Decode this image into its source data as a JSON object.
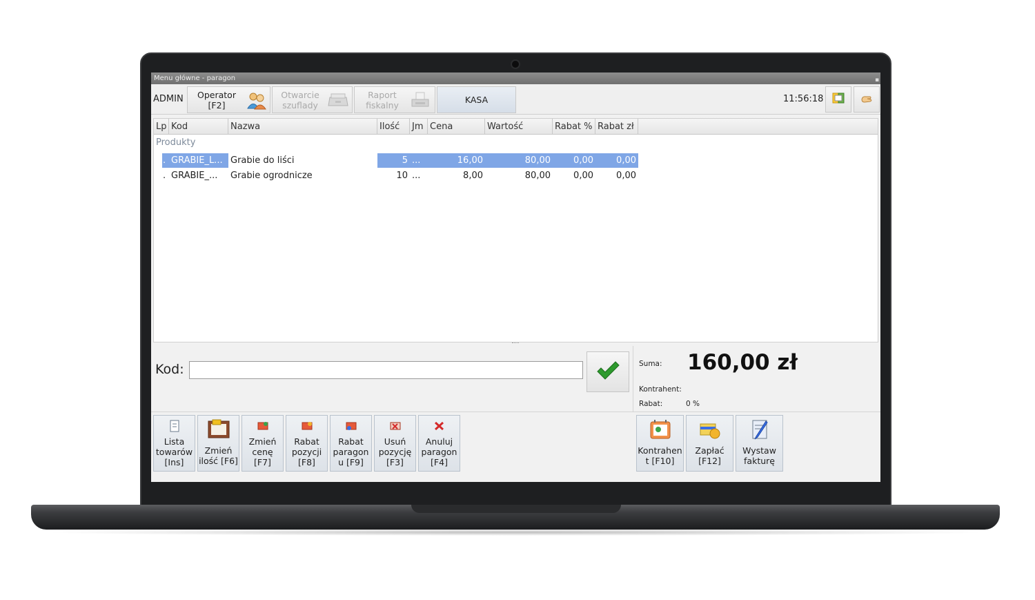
{
  "window": {
    "title": "Menu główne - paragon"
  },
  "toolbar": {
    "user": "ADMIN",
    "operator": "Operator\n[F2]",
    "drawer": "Otwarcie\nszuflady",
    "report": "Raport\nfiskalny",
    "kasa": "KASA",
    "clock": "11:56:18"
  },
  "grid": {
    "columns": [
      "Lp",
      "Kod",
      "Nazwa",
      "Ilość",
      "Jm",
      "Cena",
      "Wartość",
      "Rabat %",
      "Rabat zł"
    ],
    "group": "Produkty",
    "rows": [
      {
        "lp": ".",
        "kod": "GRABIE_L...",
        "nazwa": "Grabie do liści",
        "ilosc": "5",
        "jm": "...",
        "cena": "16,00",
        "wartosc": "80,00",
        "rabat_proc": "0,00",
        "rabat_zl": "0,00"
      },
      {
        "lp": ".",
        "kod": "GRABIE_...",
        "nazwa": "Grabie ogrodnicze",
        "ilosc": "10",
        "jm": "...",
        "cena": "8,00",
        "wartosc": "80,00",
        "rabat_proc": "0,00",
        "rabat_zl": "0,00"
      }
    ]
  },
  "kod": {
    "label": "Kod:",
    "value": ""
  },
  "summary": {
    "suma_label": "Suma:",
    "suma_value": "160,00 zł",
    "kontrahent_label": "Kontrahent:",
    "rabat_label": "Rabat:",
    "rabat_value": "0 %"
  },
  "buttons_left": [
    {
      "label": "Lista\ntowarów\n[Ins]"
    },
    {
      "label": "Zmień\nilość [F6]"
    },
    {
      "label": "Zmień\ncenę\n[F7]"
    },
    {
      "label": "Rabat\npozycji\n[F8]"
    },
    {
      "label": "Rabat\nparagon\nu [F9]"
    },
    {
      "label": "Usuń\npozycję\n[F3]"
    },
    {
      "label": "Anuluj\nparagon\n[F4]"
    }
  ],
  "buttons_right": [
    {
      "label": "Kontrahen\nt [F10]"
    },
    {
      "label": "Zapłać\n[F12]"
    },
    {
      "label": "Wystaw\nfakturę"
    }
  ],
  "colors": {
    "selection": "#7fa6e6",
    "confirm": "#2e9a2e"
  }
}
